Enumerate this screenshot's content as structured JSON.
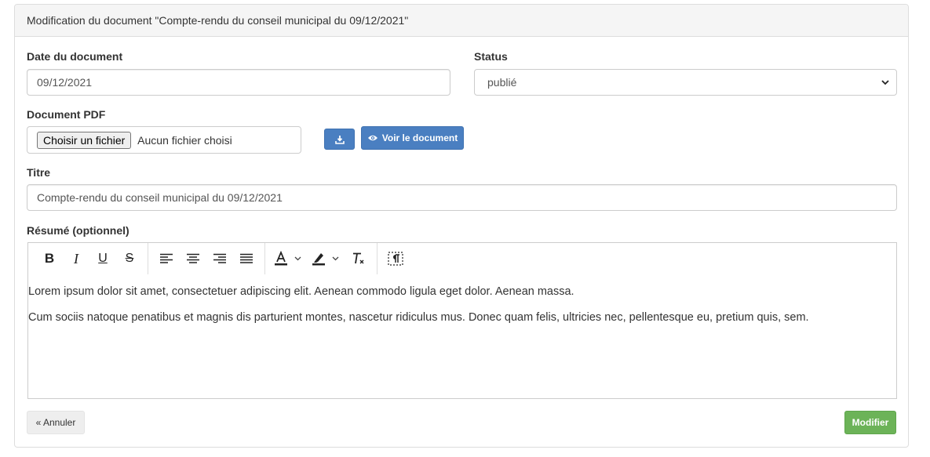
{
  "panel": {
    "heading": "Modification du document \"Compte-rendu du conseil municipal du 09/12/2021\""
  },
  "form": {
    "date_label": "Date du document",
    "date_value": "09/12/2021",
    "status_label": "Status",
    "status_value": "publié",
    "pdf_label": "Document PDF",
    "file_button": "Choisir un fichier",
    "file_status": "Aucun fichier choisi",
    "view_button": "Voir le document",
    "title_label": "Titre",
    "title_value": "Compte-rendu du conseil municipal du 09/12/2021",
    "summary_label": "Résumé (optionnel)"
  },
  "editor": {
    "toolbar": {
      "bold": "B",
      "italic": "I",
      "underline": "U",
      "strike": "S",
      "icons": [
        "bold-icon",
        "italic-icon",
        "underline-icon",
        "strikethrough-icon",
        "align-left-icon",
        "align-center-icon",
        "align-right-icon",
        "align-justify-icon",
        "text-color-icon",
        "highlight-color-icon",
        "clear-format-icon",
        "show-blocks-icon"
      ]
    },
    "paragraphs": [
      "Lorem ipsum dolor sit amet, consectetuer adipiscing elit. Aenean commodo ligula eget dolor. Aenean massa.",
      "Cum sociis natoque penatibus et magnis dis parturient montes, nascetur ridiculus mus. Donec quam felis, ultricies nec, pellentesque eu, pretium quis, sem."
    ]
  },
  "actions": {
    "cancel": "« Annuler",
    "submit": "Modifier"
  },
  "colors": {
    "primary_button": "#4a7fc1",
    "success_button": "#6cb358",
    "panel_heading_bg": "#f5f5f5"
  }
}
